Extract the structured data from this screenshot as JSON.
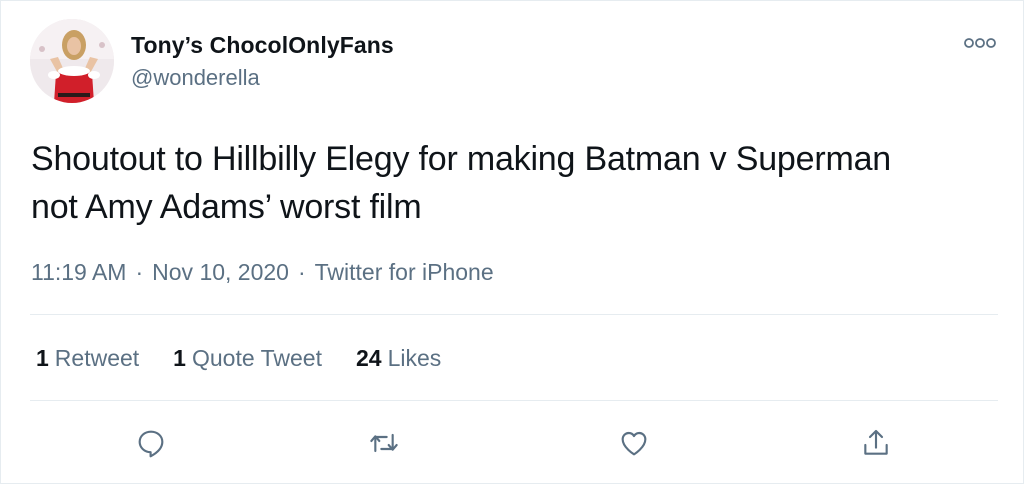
{
  "tweet": {
    "display_name": "Tony’s ChocolOnlyFans",
    "handle": "@wonderella",
    "text_line1": "Shoutout to Hillbilly Elegy for making Batman v Superman",
    "text_line2": "not Amy Adams’ worst film",
    "time": "11:19 AM",
    "date": "Nov 10, 2020",
    "source": "Twitter for iPhone",
    "separator": "·"
  },
  "stats": {
    "retweets_count": "1",
    "retweets_label": "Retweet",
    "quotes_count": "1",
    "quotes_label": "Quote Tweet",
    "likes_count": "24",
    "likes_label": "Likes"
  },
  "icons": {
    "more": "more-dots-icon",
    "reply": "reply-icon",
    "retweet": "retweet-icon",
    "like": "heart-icon",
    "share": "share-icon"
  },
  "colors": {
    "text": "#0f1419",
    "secondary": "#5b7083",
    "divider": "#e6ecf0",
    "icon": "#5b7083"
  }
}
